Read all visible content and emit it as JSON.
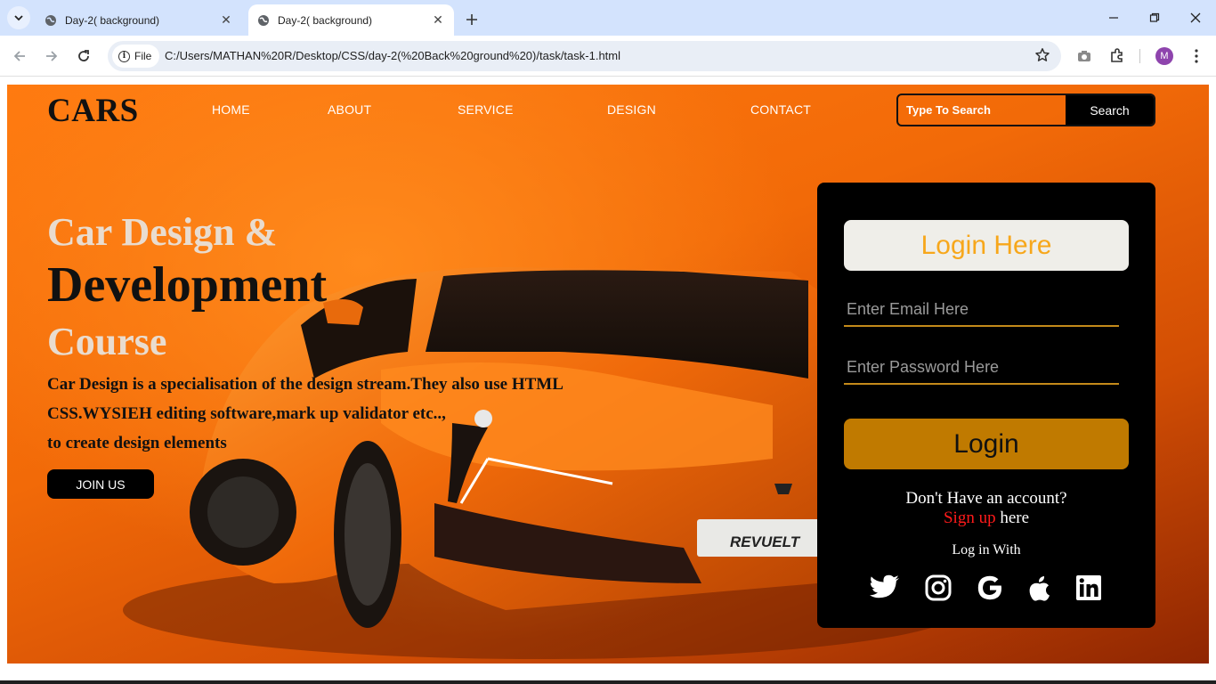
{
  "browser": {
    "tabs": [
      {
        "title": "Day-2( background)",
        "active": false
      },
      {
        "title": "Day-2( background)",
        "active": true
      }
    ],
    "file_chip": "File",
    "url": "C:/Users/MATHAN%20R/Desktop/CSS/day-2(%20Back%20ground%20)/task/task-1.html",
    "profile_initial": "M"
  },
  "page": {
    "logo": "CARS",
    "nav": [
      "HOME",
      "ABOUT",
      "SERVICE",
      "DESIGN",
      "CONTACT"
    ],
    "search": {
      "placeholder": "Type To Search",
      "button": "Search"
    },
    "hero": {
      "line1": "Car Design &",
      "line2": "Development",
      "line3": "Course",
      "description": [
        "Car Design is a specialisation of the design stream.They also use HTML",
        "CSS.WYSIEH editing software,mark up validator etc..,",
        "to create design elements"
      ],
      "join_button": "JOIN US",
      "car_plate": "REVUELTO"
    },
    "login": {
      "title": "Login Here",
      "email_placeholder": "Enter Email Here",
      "password_placeholder": "Enter Password Here",
      "button": "Login",
      "no_account": "Don't Have an account?",
      "signup_link": "Sign up",
      "signup_suffix": " here",
      "login_with": "Log in With",
      "social": [
        "twitter",
        "instagram",
        "google",
        "apple",
        "linkedin"
      ]
    }
  },
  "colors": {
    "accent_orange": "#f7a71b",
    "login_button": "#c07a00",
    "signup_red": "#ff1a1a",
    "hero_orange": "#f26a08"
  }
}
